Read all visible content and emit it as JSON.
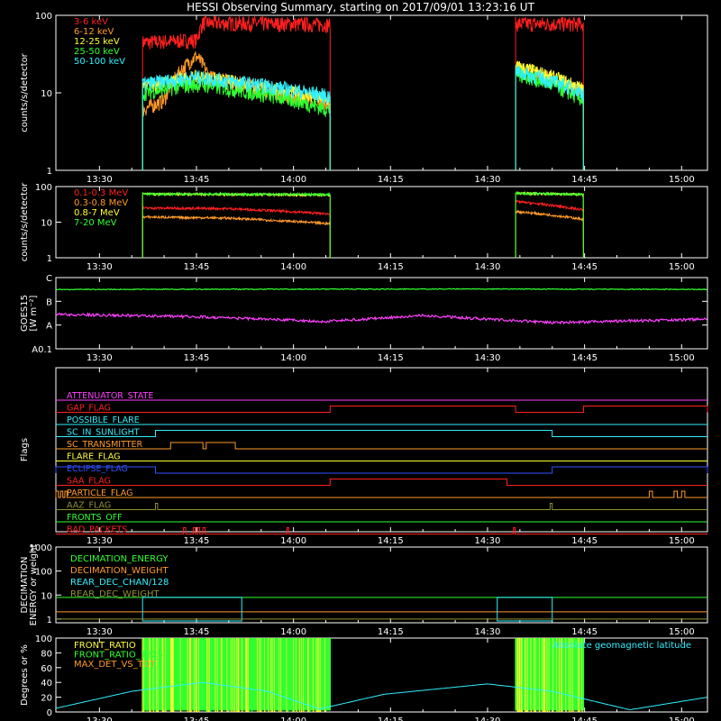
{
  "title": "HESSI Observing Summary, starting on 2017/09/01 13:23:16 UT",
  "time_axis": {
    "start": "13:23:16",
    "end": "15:04:00",
    "ticks": [
      "13:30",
      "13:45",
      "14:00",
      "14:15",
      "14:30",
      "14:45",
      "15:00"
    ]
  },
  "orbit_windows": [
    [
      "13:36:40",
      "14:05:40"
    ],
    [
      "14:34:20",
      "14:44:50"
    ]
  ],
  "colors": {
    "background": "#000000",
    "axes": "#ffffff",
    "red": "#ff2020",
    "orange": "#ff9a2a",
    "yellow": "#ffff30",
    "green": "#30ff30",
    "cyan": "#30f0ff",
    "magenta": "#ff40ff",
    "blue": "#3050ff",
    "brown": "#c08a30",
    "olive": "#909030"
  },
  "chart_data": [
    {
      "type": "line",
      "panel": "lightcurves_low",
      "ylabel": "counts/s/detector",
      "yscale": "log",
      "ylim": [
        1,
        100
      ],
      "ytick_labels": [
        "1",
        "10",
        "100"
      ],
      "series": [
        {
          "name": "3-6 keV",
          "color": "#ff2020",
          "points": [
            [
              "13:36:40",
              45
            ],
            [
              "13:45:00",
              48
            ],
            [
              "13:46:00",
              80
            ],
            [
              "14:00:00",
              78
            ],
            [
              "14:05:40",
              76
            ],
            [
              "14:34:20",
              78
            ],
            [
              "14:44:50",
              78
            ]
          ]
        },
        {
          "name": "6-12 keV",
          "color": "#ff9a2a",
          "points": [
            [
              "13:36:40",
              6
            ],
            [
              "13:40:00",
              8
            ],
            [
              "13:45:00",
              30
            ],
            [
              "13:47:00",
              16
            ],
            [
              "14:00:00",
              9
            ],
            [
              "14:05:40",
              7.5
            ],
            [
              "14:34:20",
              20
            ],
            [
              "14:40:00",
              15
            ],
            [
              "14:44:50",
              10
            ]
          ]
        },
        {
          "name": "12-25 keV",
          "color": "#ffff30",
          "points": [
            [
              "13:36:40",
              12
            ],
            [
              "13:45:00",
              16
            ],
            [
              "14:00:00",
              10
            ],
            [
              "14:05:40",
              8
            ],
            [
              "14:34:20",
              22
            ],
            [
              "14:44:50",
              11
            ]
          ]
        },
        {
          "name": "25-50 keV",
          "color": "#30ff30",
          "points": [
            [
              "13:36:40",
              10
            ],
            [
              "13:45:00",
              13
            ],
            [
              "14:00:00",
              8
            ],
            [
              "14:05:40",
              6
            ],
            [
              "14:34:20",
              18
            ],
            [
              "14:44:50",
              8
            ]
          ]
        },
        {
          "name": "50-100 keV",
          "color": "#30f0ff",
          "points": [
            [
              "13:36:40",
              13
            ],
            [
              "13:45:00",
              16
            ],
            [
              "14:00:00",
              11
            ],
            [
              "14:05:40",
              9
            ],
            [
              "14:34:20",
              19
            ],
            [
              "14:44:50",
              10
            ]
          ]
        }
      ]
    },
    {
      "type": "line",
      "panel": "lightcurves_high",
      "ylabel": "counts/s/detector",
      "yscale": "log",
      "ylim": [
        1,
        100
      ],
      "ytick_labels": [
        "1",
        "10",
        "100"
      ],
      "series": [
        {
          "name": "0.1-0.3 MeV",
          "color": "#ff2020",
          "points": [
            [
              "13:36:40",
              25
            ],
            [
              "13:50:00",
              24
            ],
            [
              "14:05:40",
              17
            ],
            [
              "14:34:20",
              38
            ],
            [
              "14:44:50",
              22
            ]
          ]
        },
        {
          "name": "0.3-0.8 MeV",
          "color": "#ff9a2a",
          "points": [
            [
              "13:36:40",
              14
            ],
            [
              "13:50:00",
              13
            ],
            [
              "14:05:40",
              9
            ],
            [
              "14:34:20",
              20
            ],
            [
              "14:44:50",
              12
            ]
          ]
        },
        {
          "name": "0.8-7 MeV",
          "color": "#ffff30",
          "points": [
            [
              "13:36:40",
              62
            ],
            [
              "13:50:00",
              60
            ],
            [
              "14:05:40",
              58
            ],
            [
              "14:34:20",
              65
            ],
            [
              "14:44:50",
              60
            ]
          ]
        },
        {
          "name": "7-20 MeV",
          "color": "#30ff30",
          "points": [
            [
              "13:36:40",
              62
            ],
            [
              "14:05:40",
              60
            ],
            [
              "14:34:20",
              64
            ],
            [
              "14:44:50",
              60
            ]
          ]
        }
      ]
    },
    {
      "type": "line",
      "panel": "goes",
      "ylabel": "GOES15",
      "ylabel2": "[W m⁻²]",
      "ytick_labels": [
        "A0.1",
        "A",
        "B",
        "C"
      ],
      "series": [
        {
          "name": "",
          "color": "#30ff30",
          "band": "B",
          "level": 0.5,
          "points": [
            [
              "13:23:16",
              0.5
            ],
            [
              "14:30:00",
              0.52
            ],
            [
              "15:04:00",
              0.5
            ]
          ]
        },
        {
          "name": "",
          "color": "#ff40ff",
          "band": "A",
          "level": 0.3,
          "points": [
            [
              "13:23:16",
              0.45
            ],
            [
              "13:45:00",
              0.35
            ],
            [
              "14:05:00",
              0.15
            ],
            [
              "14:20:00",
              0.4
            ],
            [
              "14:40:00",
              0.1
            ],
            [
              "15:04:00",
              0.25
            ]
          ]
        }
      ]
    },
    {
      "type": "line",
      "panel": "flags",
      "ylabel": "Flags",
      "flags": [
        {
          "name": "ATTENUATOR_STATE",
          "color": "#ff40ff",
          "segments": []
        },
        {
          "name": "GAP_FLAG",
          "color": "#ff2020",
          "segments": [
            [
              "14:05:40",
              "14:34:20"
            ],
            [
              "14:44:50",
              "15:04:00"
            ]
          ]
        },
        {
          "name": "POSSIBLE_FLARE",
          "color": "#30f0ff",
          "segments": []
        },
        {
          "name": "SC_IN_SUNLIGHT",
          "color": "#30f0ff",
          "segments": [
            [
              "13:38:40",
              "14:40:00"
            ]
          ]
        },
        {
          "name": "SC_TRANSMITTER",
          "color": "#ff9a2a",
          "segments": [
            [
              "13:41:00",
              "13:46:00"
            ],
            [
              "13:46:30",
              "13:51:00"
            ]
          ]
        },
        {
          "name": "FLARE_FLAG",
          "color": "#ffff30",
          "segments": []
        },
        {
          "name": "ECLIPSE_FLAG",
          "color": "#3050ff",
          "segments": [
            [
              "13:23:16",
              "13:38:40"
            ],
            [
              "14:40:00",
              "15:04:00"
            ]
          ]
        },
        {
          "name": "SAA_FLAG",
          "color": "#ff2020",
          "segments": [
            [
              "14:05:40",
              "14:33:00"
            ]
          ]
        },
        {
          "name": "PARTICLE_FLAG",
          "color": "#ff9a2a",
          "segments": [
            [
              "13:23:16",
              "13:23:40"
            ],
            [
              "13:24:00",
              "13:24:20"
            ],
            [
              "13:24:40",
              "13:25:00"
            ],
            [
              "14:55:00",
              "14:55:30"
            ],
            [
              "14:58:50",
              "14:59:20"
            ],
            [
              "15:00:00",
              "15:00:30"
            ]
          ]
        },
        {
          "name": "AAZ_FLAG",
          "color": "#909030",
          "segments": [
            [
              "13:38:40",
              "13:39:00"
            ],
            [
              "14:39:40",
              "14:40:00"
            ]
          ]
        },
        {
          "name": "FRONTS_OFF",
          "color": "#30ff30",
          "segments": []
        },
        {
          "name": "BAD_PACKETS",
          "color": "#ff2020",
          "segments": [
            [
              "13:43:00",
              "13:43:20"
            ],
            [
              "13:44:30",
              "13:44:50"
            ],
            [
              "13:45:10",
              "13:45:30"
            ],
            [
              "13:46:00",
              "13:46:20"
            ],
            [
              "13:59:00",
              "13:59:15"
            ],
            [
              "14:34:00",
              "14:34:15"
            ]
          ]
        }
      ]
    },
    {
      "type": "line",
      "panel": "decimation",
      "ylabel": "DECIMATION",
      "ylabel2": "ENERGY or weight",
      "yscale": "log",
      "ylim": [
        0.7,
        1000
      ],
      "ytick_labels": [
        "1",
        "10",
        "100",
        "1000"
      ],
      "series": [
        {
          "name": "DECIMATION_ENERGY",
          "color": "#30ff30",
          "points": [
            [
              "13:23:16",
              8
            ],
            [
              "15:04:00",
              8
            ]
          ]
        },
        {
          "name": "DECIMATION_WEIGHT",
          "color": "#ff9a2a",
          "points": [
            [
              "13:23:16",
              2
            ],
            [
              "15:04:00",
              2
            ]
          ]
        },
        {
          "name": "REAR_DEC_CHAN/128",
          "color": "#30f0ff",
          "points": [
            [
              "13:36:40",
              8
            ],
            [
              "13:52:00",
              8
            ],
            [
              "14:31:30",
              8
            ],
            [
              "14:40:00",
              8
            ]
          ]
        },
        {
          "name": "REAR_DEC_WEIGHT",
          "color": "#909030",
          "points": [
            [
              "13:23:16",
              1
            ],
            [
              "15:04:00",
              1
            ]
          ]
        }
      ]
    },
    {
      "type": "line",
      "panel": "ratios",
      "ylabel": "Degrees or %",
      "ylim": [
        0,
        100
      ],
      "ytick_labels": [
        "0",
        "20",
        "40",
        "60",
        "80",
        "100"
      ],
      "annotation": "Absolute geomagnetic latitude",
      "series": [
        {
          "name": "FRONT_RATIO",
          "color": "#ffff30",
          "points": []
        },
        {
          "name": "FRONT_RATIO_1225",
          "color": "#30ff30",
          "points": []
        },
        {
          "name": "MAX_DET_VS_TOT",
          "color": "#ff9a2a",
          "points": []
        },
        {
          "name": "",
          "color": "#30f0ff",
          "points": [
            [
              "13:23:16",
              5
            ],
            [
              "13:35:00",
              28
            ],
            [
              "13:46:00",
              40
            ],
            [
              "13:56:00",
              28
            ],
            [
              "14:04:00",
              4
            ],
            [
              "14:14:00",
              24
            ],
            [
              "14:30:00",
              38
            ],
            [
              "14:40:00",
              28
            ],
            [
              "14:52:00",
              3
            ],
            [
              "15:04:00",
              20
            ]
          ]
        }
      ]
    }
  ]
}
